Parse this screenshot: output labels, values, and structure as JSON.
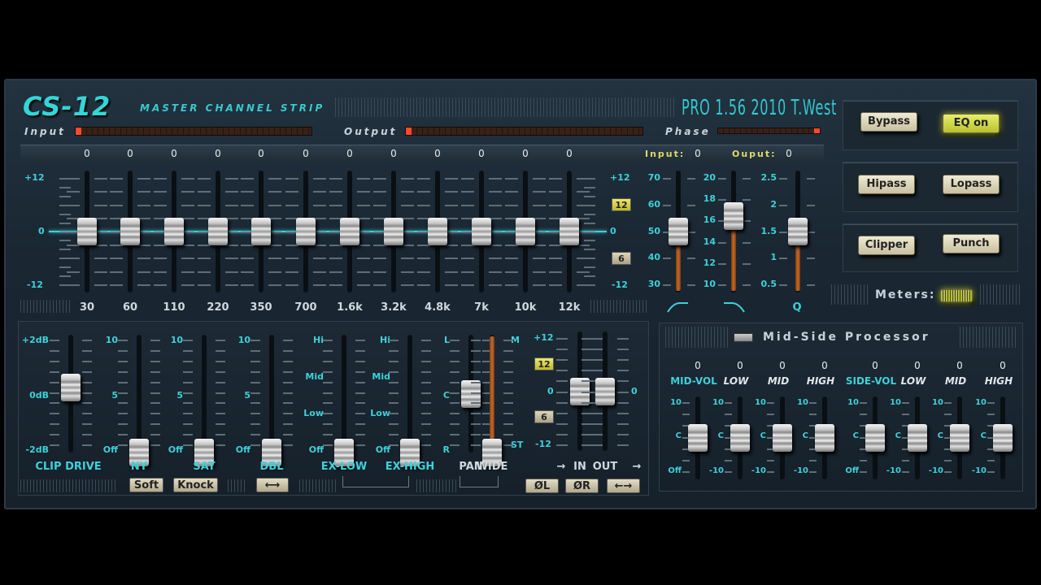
{
  "header": {
    "title": "CS-12",
    "subtitle": "MASTER CHANNEL STRIP",
    "version": "PRO 1.56 2010 T.West"
  },
  "meters": {
    "input_label": "Input",
    "output_label": "Output",
    "phase_label": "Phase"
  },
  "eq": {
    "band_values": [
      "0",
      "0",
      "0",
      "0",
      "0",
      "0",
      "0",
      "0",
      "0",
      "0",
      "0",
      "0"
    ],
    "bands": [
      {
        "freq": "30",
        "value": 0
      },
      {
        "freq": "60",
        "value": 0
      },
      {
        "freq": "110",
        "value": 0
      },
      {
        "freq": "220",
        "value": 0
      },
      {
        "freq": "350",
        "value": 0
      },
      {
        "freq": "700",
        "value": 0
      },
      {
        "freq": "1.6k",
        "value": 0
      },
      {
        "freq": "3.2k",
        "value": 0
      },
      {
        "freq": "4.8k",
        "value": 0
      },
      {
        "freq": "7k",
        "value": 0
      },
      {
        "freq": "10k",
        "value": 0
      },
      {
        "freq": "12k",
        "value": 0
      }
    ],
    "scale_left": [
      "+12",
      "0",
      "-12"
    ],
    "scale_right": [
      "+12",
      "0",
      "-12"
    ],
    "range_badges": [
      "12",
      "6"
    ],
    "range_selected": "12",
    "input_label": "Input:",
    "input_value": "0",
    "output_label": "Ouput:",
    "output_value": "0",
    "line_color": "#3fd0d8"
  },
  "filters": {
    "hipass": {
      "scale": [
        "70",
        "60",
        "50",
        "40",
        "30"
      ],
      "value": 50,
      "range": [
        30,
        70
      ],
      "icon": "hipass-curve-icon"
    },
    "lopass": {
      "scale": [
        "20",
        "18",
        "16",
        "14",
        "12",
        "10"
      ],
      "value": 16.3,
      "range": [
        10,
        20
      ],
      "icon": "lopass-curve-icon"
    },
    "q": {
      "scale": [
        "2.5",
        "2",
        "1.5",
        "1",
        "0.5"
      ],
      "value": 1.5,
      "range": [
        0.5,
        2.5
      ],
      "label": "Q"
    }
  },
  "buttons": {
    "bypass": "Bypass",
    "eq_on": "EQ on",
    "hipass": "Hipass",
    "lopass": "Lopass",
    "clipper": "Clipper",
    "punch": "Punch",
    "meters_label": "Meters:",
    "active": [
      "EQ on"
    ]
  },
  "dynamics": {
    "clip_drive": {
      "label": "CLIP DRIVE",
      "scale": [
        "+2dB",
        "0dB",
        "-2dB"
      ],
      "value": 0.2,
      "range": [
        -2,
        2
      ]
    },
    "ny": {
      "label": "NY",
      "scale": [
        "10",
        "5",
        "Off"
      ],
      "value": 0,
      "range": [
        0,
        10
      ]
    },
    "sat": {
      "label": "SAT",
      "scale": [
        "10",
        "5",
        "Off"
      ],
      "value": 0,
      "range": [
        0,
        10
      ]
    },
    "dbl": {
      "label": "DBL",
      "scale": [
        "10",
        "5",
        "Off"
      ],
      "value": 0,
      "range": [
        0,
        10
      ]
    },
    "ex_low": {
      "label": "EX-LOW",
      "scale": [
        "Hi",
        "Mid",
        "Low",
        "Off"
      ],
      "value": 0,
      "range": [
        0,
        3
      ]
    },
    "ex_high": {
      "label": "EX-HIGH",
      "scale": [
        "Hi",
        "Mid",
        "Low",
        "Off"
      ],
      "value": 0,
      "range": [
        0,
        3
      ]
    },
    "pan": {
      "label": "PAN",
      "scale": [
        "L",
        "C",
        "R"
      ],
      "value": 0,
      "range": [
        -1,
        1
      ]
    },
    "wide": {
      "label": "WIDE",
      "scale": [
        "M",
        "ST"
      ],
      "value": 0,
      "range": [
        0,
        1
      ]
    },
    "in": {
      "label": "IN",
      "value": 0,
      "range": [
        -12,
        12
      ]
    },
    "out": {
      "label": "OUT",
      "value": 0,
      "range": [
        -12,
        12
      ]
    },
    "io_scale": [
      "+12",
      "0",
      "-12"
    ],
    "io_scale_right": "0",
    "io_badges": [
      "12",
      "6"
    ],
    "soft": "Soft",
    "knock": "Knock",
    "dbl_button": "⟷",
    "phase_l": "ØL",
    "phase_r": "ØR",
    "swap": "←→"
  },
  "mid_side": {
    "title": "Mid-Side Processor",
    "channels": [
      {
        "label": "MID-VOL",
        "value": "0",
        "scale": [
          "10",
          "C",
          "Off"
        ]
      },
      {
        "label": "LOW",
        "value": "0",
        "scale": [
          "10",
          "C",
          "-10"
        ]
      },
      {
        "label": "MID",
        "value": "0",
        "scale": [
          "10",
          "C",
          "-10"
        ]
      },
      {
        "label": "HIGH",
        "value": "0",
        "scale": [
          "10",
          "C",
          "-10"
        ]
      },
      {
        "label": "SIDE-VOL",
        "value": "0",
        "scale": [
          "10",
          "C",
          "Off"
        ]
      },
      {
        "label": "LOW",
        "value": "0",
        "scale": [
          "10",
          "C",
          "-10"
        ]
      },
      {
        "label": "MID",
        "value": "0",
        "scale": [
          "10",
          "C",
          "-10"
        ]
      },
      {
        "label": "HIGH",
        "value": "0",
        "scale": [
          "10",
          "C",
          "-10"
        ]
      }
    ]
  }
}
